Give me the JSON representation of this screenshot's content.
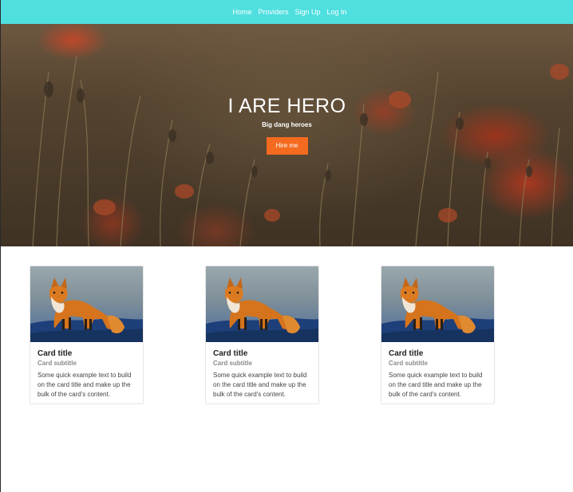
{
  "nav": {
    "links": [
      {
        "label": "Home"
      },
      {
        "label": "Providers"
      },
      {
        "label": "Sign Up"
      },
      {
        "label": "Log In"
      }
    ]
  },
  "hero": {
    "title": "I ARE HERO",
    "subtitle": "Big dang heroes",
    "button_label": "Hire me"
  },
  "cards": [
    {
      "title": "Card title",
      "subtitle": "Card subtitle",
      "text": "Some quick example text to build on the card title and make up the bulk of the card's content."
    },
    {
      "title": "Card title",
      "subtitle": "Card subtitle",
      "text": "Some quick example text to build on the card title and make up the bulk of the card's content."
    },
    {
      "title": "Card title",
      "subtitle": "Card subtitle",
      "text": "Some quick example text to build on the card title and make up the bulk of the card's content."
    }
  ],
  "colors": {
    "navbar": "#4fdfdf",
    "button": "#f46a1f"
  }
}
